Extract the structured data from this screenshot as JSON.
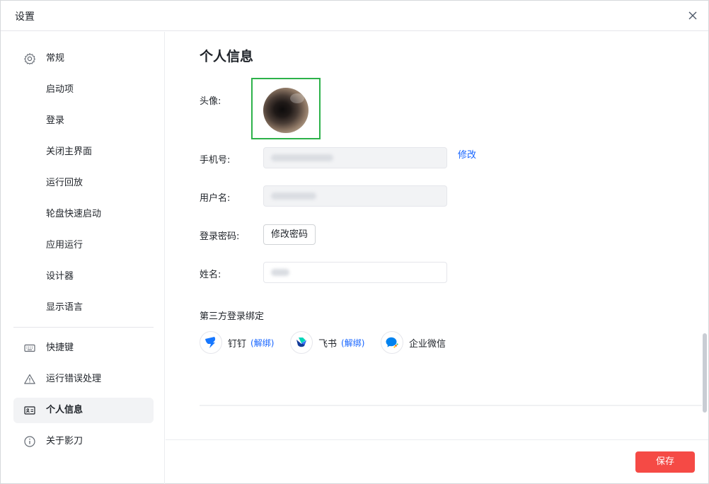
{
  "window": {
    "title": "设置"
  },
  "sidebar": {
    "items": [
      {
        "label": "常规",
        "icon": "gear-icon"
      },
      {
        "label": "启动项"
      },
      {
        "label": "登录"
      },
      {
        "label": "关闭主界面"
      },
      {
        "label": "运行回放"
      },
      {
        "label": "轮盘快速启动"
      },
      {
        "label": "应用运行"
      },
      {
        "label": "设计器"
      },
      {
        "label": "显示语言"
      },
      {
        "label": "快捷键",
        "icon": "keyboard-icon"
      },
      {
        "label": "运行错误处理",
        "icon": "warning-icon"
      },
      {
        "label": "个人信息",
        "icon": "id-card-icon",
        "active": true
      },
      {
        "label": "关于影刀",
        "icon": "info-icon"
      }
    ]
  },
  "main": {
    "section_title": "个人信息",
    "avatar_label": "头像:",
    "phone_label": "手机号:",
    "phone_action": "修改",
    "username_label": "用户名:",
    "password_label": "登录密码:",
    "password_button": "修改密码",
    "name_label": "姓名:",
    "third_party": {
      "title": "第三方登录绑定",
      "items": [
        {
          "name": "钉钉",
          "action": "(解绑)",
          "icon": "dingtalk-icon"
        },
        {
          "name": "飞书",
          "action": "(解绑)",
          "icon": "feishu-icon"
        },
        {
          "name": "企业微信",
          "icon": "wecom-icon"
        }
      ]
    }
  },
  "footer": {
    "save_label": "保存"
  },
  "colors": {
    "accent": "#1664ff",
    "save": "#f54a45",
    "avatar_border": "#2db24a"
  }
}
